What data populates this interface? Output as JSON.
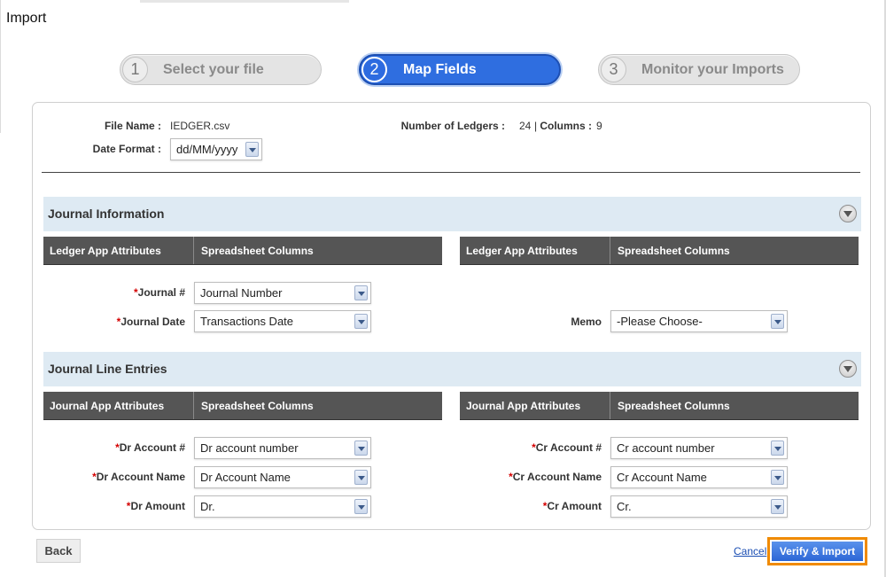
{
  "page": {
    "title": "Import"
  },
  "steps": [
    {
      "num": "1",
      "label": "Select your file"
    },
    {
      "num": "2",
      "label": "Map Fields"
    },
    {
      "num": "3",
      "label": "Monitor your Imports"
    }
  ],
  "file_info": {
    "file_name_label": "File Name :",
    "file_name": "IEDGER.csv",
    "date_format_label": "Date Format :",
    "date_format": "dd/MM/yyyy",
    "ledgers_label": "Number of Ledgers :",
    "ledgers": "24",
    "separator": "|",
    "columns_label": "Columns :",
    "columns": "9"
  },
  "journal_info": {
    "title": "Journal Information",
    "left_header": {
      "attr": "Ledger App Attributes",
      "col": "Spreadsheet Columns"
    },
    "right_header": {
      "attr": "Ledger App Attributes",
      "col": "Spreadsheet Columns"
    },
    "journal_num": {
      "label": "Journal #",
      "value": "Journal Number"
    },
    "journal_date": {
      "label": "Journal Date",
      "value": "Transactions Date"
    },
    "memo": {
      "label": "Memo",
      "value": "-Please Choose-"
    }
  },
  "journal_lines": {
    "title": "Journal Line Entries",
    "left_header": {
      "attr": "Journal App Attributes",
      "col": "Spreadsheet Columns"
    },
    "right_header": {
      "attr": "Journal App Attributes",
      "col": "Spreadsheet Columns"
    },
    "dr_account_num": {
      "label": "Dr Account #",
      "value": "Dr account number"
    },
    "dr_account_name": {
      "label": "Dr Account Name",
      "value": "Dr Account Name"
    },
    "dr_amount": {
      "label": "Dr Amount",
      "value": "Dr."
    },
    "cr_account_num": {
      "label": "Cr Account #",
      "value": "Cr account number"
    },
    "cr_account_name": {
      "label": "Cr Account Name",
      "value": "Cr Account Name"
    },
    "cr_amount": {
      "label": "Cr Amount",
      "value": "Cr."
    }
  },
  "required_mark": "*",
  "actions": {
    "back": "Back",
    "cancel": "Cancel",
    "verify": "Verify & Import"
  },
  "colors": {
    "active_step": "#2f6ee0",
    "section_bar": "#deeaf3",
    "header_bar": "#555555",
    "verify_outline": "#f08a00"
  }
}
